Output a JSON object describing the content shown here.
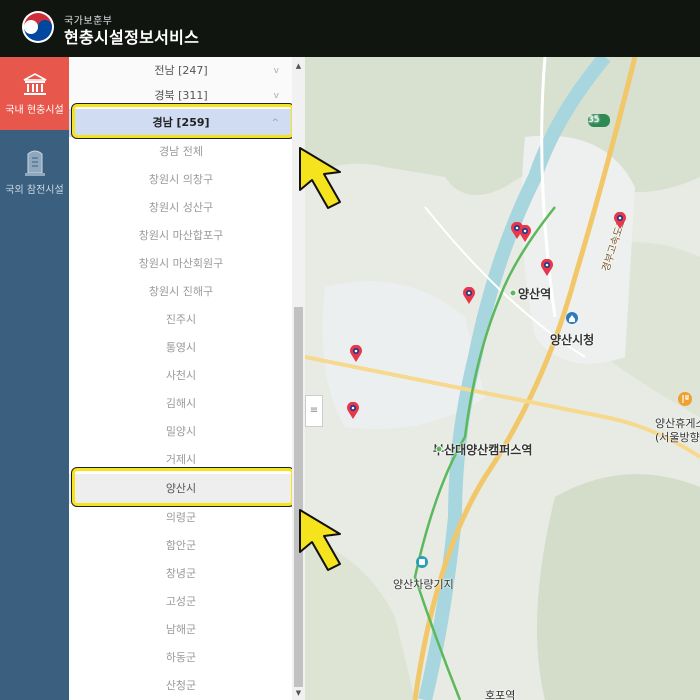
{
  "header": {
    "subtitle": "국가보훈부",
    "title": "현충시설정보서비스"
  },
  "leftnav": {
    "items": [
      {
        "label": "국내 현충시설",
        "icon": "monument-icon",
        "active": true
      },
      {
        "label": "국외 참전시설",
        "icon": "memorial-stone-icon",
        "active": false
      }
    ]
  },
  "region_list": {
    "provinces_above": [
      {
        "label": "전남 [247]"
      },
      {
        "label": "경북 [311]"
      }
    ],
    "selected_province": {
      "label": "경남 [259]"
    },
    "cities": [
      "경남 전체",
      "창원시 의창구",
      "창원시 성산구",
      "창원시 마산합포구",
      "창원시 마산회원구",
      "창원시 진해구",
      "진주시",
      "통영시",
      "사천시",
      "김해시",
      "밀양시",
      "거제시",
      "양산시",
      "의령군",
      "함안군",
      "창녕군",
      "고성군",
      "남해군",
      "하동군",
      "산청군"
    ],
    "selected_city": "양산시"
  },
  "map": {
    "labels": {
      "yangsan_station": "양산역",
      "yangsan_city_hall": "양산시청",
      "campus_station": "부산대양산캠퍼스역",
      "yangsan_depot": "양산차량기지",
      "rest_area": "양산휴게소",
      "rest_area_dir": "(서울방향)",
      "route_35": "35",
      "expressway": "경부고속도로",
      "bottom_partial": "호포역"
    },
    "colors": {
      "marker": "#e8364a",
      "marker_cap": "#1a3a8a",
      "rail": "#5cb85c",
      "road": "#f1c76a",
      "river": "#9fd3dc"
    }
  },
  "annotations": {
    "arrow_color": "#f5e31d"
  }
}
